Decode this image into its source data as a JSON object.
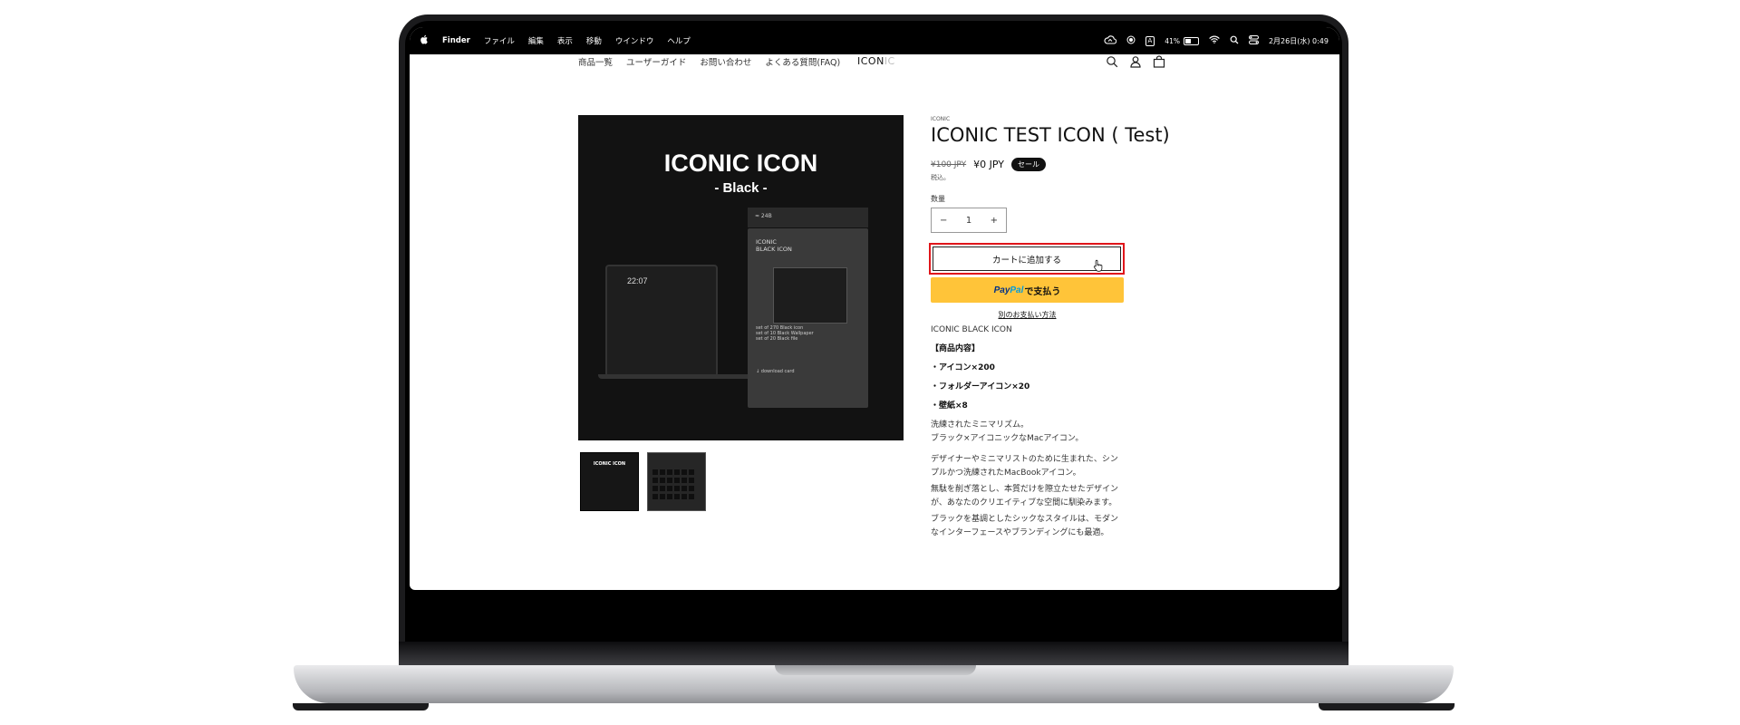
{
  "menubar": {
    "apple": "",
    "items": [
      "Finder",
      "ファイル",
      "編集",
      "表示",
      "移動",
      "ウインドウ",
      "ヘルプ"
    ],
    "battery_percent": "41%",
    "datetime": "2月26日(水) 0:49",
    "input_method": "A"
  },
  "store": {
    "nav": [
      "商品一覧",
      "ユーザーガイド",
      "お問い合わせ",
      "よくある質問(FAQ)"
    ],
    "logo_main": "ICON",
    "logo_dim": "IC"
  },
  "product_image": {
    "title": "ICONIC ICON",
    "subtitle": "- Black -",
    "time": "22:07",
    "card_tab": "≈ 24B",
    "card_title": "ICONIC\nBLACK ICON",
    "card_lines": "set of 270 Black icon\nset of 10 Black Wallpaper\nset of 20 Black file\n\n\n\n\n\n↓ download card",
    "thumb1_title": "ICONIC ICON"
  },
  "product": {
    "vendor": "ICONIC",
    "title": "ICONIC TEST ICON ( Test)",
    "old_price": "¥100 JPY",
    "price": "¥0 JPY",
    "sale_badge": "セール",
    "tax_note": "税込。",
    "quantity_label": "数量",
    "quantity_value": "1",
    "minus": "−",
    "plus": "+",
    "add_to_cart": "カートに追加する",
    "paypal_pay": "Pay",
    "paypal_pal": "Pal",
    "paypal_suffix": "で支払う",
    "other_payment": "別のお支払い方法"
  },
  "description": {
    "heading": "ICONIC BLACK ICON",
    "contents_title": "【商品内容】",
    "item1": "・アイコン×200",
    "item2": "・フォルダーアイコン×20",
    "item3": "・壁紙×8",
    "para1_line1": "洗練されたミニマリズム。",
    "para1_line2": "ブラック×アイコニックなMacアイコン。",
    "para2_line1": "デザイナーやミニマリストのために生まれた、シンプルかつ洗練されたMacBookアイコン。",
    "para2_line2": "無駄を削ぎ落とし、本質だけを際立たせたデザインが、あなたのクリエイティブな空間に馴染みます。",
    "para2_line3": "ブラックを基調としたシックなスタイルは、モダンなインターフェースやブランディングにも最適。"
  },
  "colors": {
    "highlight": "#e0161b",
    "paypal_yellow": "#ffc439",
    "paypal_blue": "#003087",
    "paypal_light_blue": "#009cde"
  }
}
